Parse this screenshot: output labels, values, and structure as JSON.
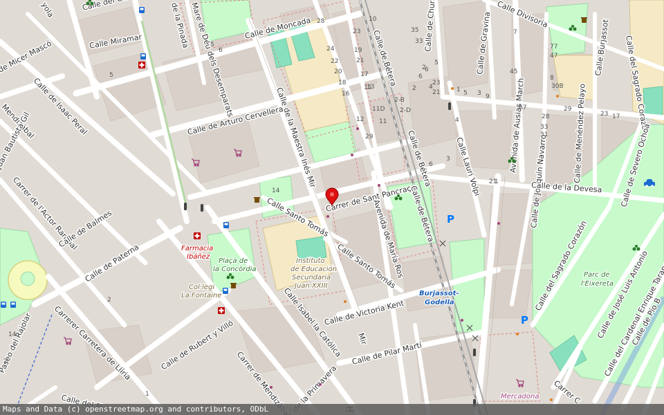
{
  "streets": {
    "moncada": "Calle de Moncada",
    "miramar": "Calle Miramar",
    "micer_masco": "de Micer Mascó",
    "isaac_peral": "Calle de Isaac Peral",
    "mendizabal_top": "Mendizábal",
    "juan_bautista_gil": "Juan Bautista Gil",
    "actor_rambal": "Carrer de l'Actor Rambal",
    "balmes": "Calle de Balmes",
    "paterna": "Calle de Paterna",
    "carretera_lliria": "Carrerer Carretera de Llíria",
    "paseo_rajolar": "Paseo del Rajolar",
    "arturo_cervellera": "Calle de Arturo Cervellera",
    "mare_deu": "Mare de Déu dels Desemparats",
    "pinada": "de la Pinada",
    "garbi": "Calle del Garbí",
    "maestra_ines": "Calle de la Maestra Inés Mir",
    "santo_tomas_1": "Calle Santo Tomás",
    "santo_tomas_2": "Calle Santo Tomás",
    "sant_pancrac": "Carrer de Sant Pancraç",
    "maria_ros": "Avenida de María Ros",
    "betera_1": "Calle de Bétera",
    "betera_2": "Calle de Bétera",
    "betera_3": "Calle de Bétera",
    "isabel_catolica": "Calle Isabel la Católica",
    "victoria_kent": "Calle de Victoria Kent",
    "pilar_marti": "Calle de Pilar Martí",
    "rubert_villo": "Calle de Rubert y Villó",
    "mendizabal_bottom": "Carrer de Mendizàbal",
    "primavera": "de la Primavera",
    "mir_bottom": "Mir",
    "churruca": "Calle de Churruca",
    "gravina": "Calle de Gravina",
    "divisoria": "Calle Divisoria",
    "ausias_march": "Avenida de Ausias March",
    "lauri_volpi": "Calle Lauri Volpi",
    "joaquin_navarro": "Calle de Joaquín Navarro",
    "menendez_pelayo": "Calle de Menéndez Pelayo",
    "burjassot": "Calle Burjassot",
    "sagrado_corazon_top": "Calle del Sagrado Corazón",
    "severo_ochoa": "Calle de Severo Ochoa",
    "devesa": "Calle de la Devesa",
    "sagrado_corazon_bottom": "Calle del Sagrado Corazón",
    "jose_luis_antonio": "Calle de José Luis Antonio",
    "cardenal_taranc": "Calle del Cardenal Enrique Taranc",
    "pio": "Calle de Pío B",
    "pi_top": "Calle del Pi",
    "carrer_c": "Carrer C",
    "yola": "yola",
    "fragment_c": "C"
  },
  "pois": {
    "farmacia_line1": "Farmacia",
    "farmacia_line2": "Ibáñez",
    "placa_line1": "Plaça de",
    "placa_line2": "la Concòrdia",
    "colegi_line1": "Col·legi",
    "colegi_line2": "La Fontaine",
    "instituto_line1": "Instituto",
    "instituto_line2": "de Educación",
    "instituto_line3": "Secundaria",
    "instituto_line4": "Juan XXIII",
    "station_line1": "Burjassot-",
    "station_line2": "Godella",
    "parc_line1": "Parc de",
    "parc_line2": "l'Eixereta",
    "mercadona": "Mercadona",
    "parking_symbol": "P"
  },
  "house_numbers": [
    "28",
    "23",
    "24",
    "22",
    "20",
    "18",
    "16",
    "19",
    "21",
    "17",
    "15",
    "13",
    "12",
    "11D",
    "11",
    "29",
    "10",
    "35",
    "33",
    "6",
    "5",
    "2",
    "4",
    "23",
    "21",
    "2-B",
    "2-D",
    "1",
    "5",
    "3",
    "9",
    "7",
    "77",
    "47",
    "45",
    "67",
    "8",
    "30B",
    "28",
    "33",
    "31",
    "29",
    "17",
    "23",
    "21",
    "1",
    "3",
    "4",
    "6",
    "2",
    "14",
    "2",
    "1",
    "14",
    "6",
    "5",
    "5",
    "6",
    "2",
    "2"
  ],
  "icons": {
    "marker": "location-pin-icon",
    "pharmacy": "pharmacy-cross-icon",
    "bus": "bus-stop-icon",
    "shop": "shopping-cart-icon",
    "playground": "playground-icon",
    "fountain": "drinking-water-icon",
    "parking": "parking-icon",
    "taxi": "taxi-icon",
    "justice": "courthouse-icon"
  },
  "colors": {
    "background": "#f2efe9",
    "residential": "#e0dbd4",
    "road": "#ffffff",
    "park": "#c8facc",
    "school": "#fff2c0",
    "pitch": "#88e0be",
    "railway": "#999999",
    "pharmacy": "#c00000",
    "marker": "#e01010",
    "station_text": "#1a5fb4",
    "poi_green": "#2a7a2a"
  },
  "attribution": "Maps and Data (c) openstreetmap.org and contributors, ODbL"
}
